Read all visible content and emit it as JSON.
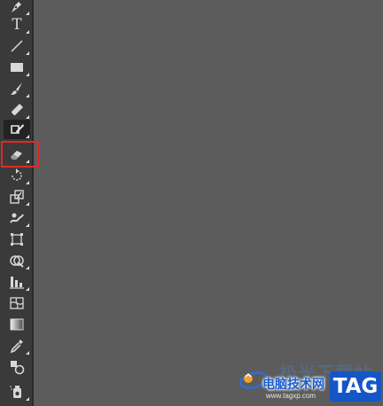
{
  "toolbar": {
    "tools": [
      {
        "icon": "pen-icon"
      },
      {
        "icon": "type-icon",
        "glyph": "T"
      },
      {
        "icon": "line-segment-icon"
      },
      {
        "icon": "rectangle-icon"
      },
      {
        "icon": "paintbrush-icon"
      },
      {
        "icon": "pencil-icon"
      },
      {
        "icon": "shaper-icon",
        "active": true
      },
      {
        "icon": "eraser-icon",
        "highlighted": true
      },
      {
        "icon": "rotate-icon"
      },
      {
        "icon": "scale-icon"
      },
      {
        "icon": "warp-icon"
      },
      {
        "icon": "free-transform-icon"
      },
      {
        "icon": "shape-builder-icon"
      },
      {
        "icon": "graph-icon"
      },
      {
        "icon": "mesh-icon"
      },
      {
        "icon": "gradient-icon"
      },
      {
        "icon": "eyedropper-icon"
      },
      {
        "icon": "blend-icon"
      },
      {
        "icon": "symbol-sprayer-icon"
      }
    ]
  },
  "highlight_color": "#e02a25",
  "watermark": {
    "brand": "电脑技术网",
    "url": "www.tagxp.com",
    "tag": "TAG",
    "faded_text": "极光下载站"
  }
}
